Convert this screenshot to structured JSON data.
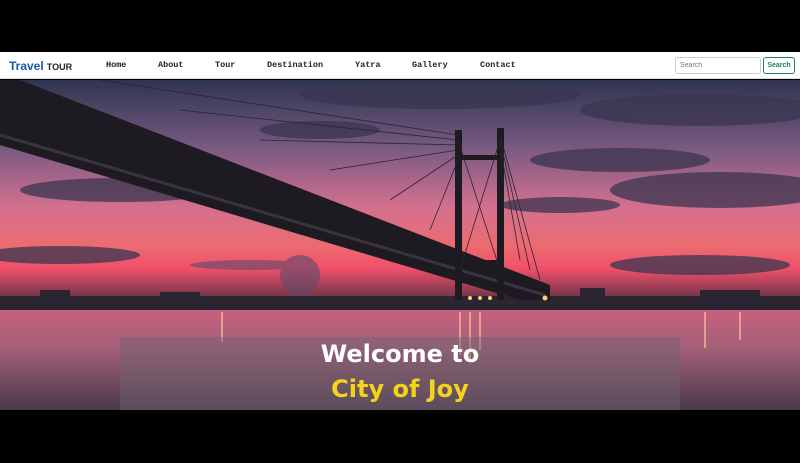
{
  "navbar": {
    "brand_primary": "Travel",
    "brand_secondary": "TOUR",
    "items": [
      {
        "label": "Home"
      },
      {
        "label": "About"
      },
      {
        "label": "Tour"
      },
      {
        "label": "Destination"
      },
      {
        "label": "Yatra"
      },
      {
        "label": "Gallery"
      },
      {
        "label": "Contact"
      }
    ],
    "search_placeholder": "Search",
    "search_button": "Search"
  },
  "hero": {
    "caption_line1": "Welcome to",
    "caption_line2": "City of Joy",
    "caption_line2_color": "#f5d31a"
  },
  "colors": {
    "brand_blue": "#1a56a6",
    "search_green": "#198754"
  }
}
